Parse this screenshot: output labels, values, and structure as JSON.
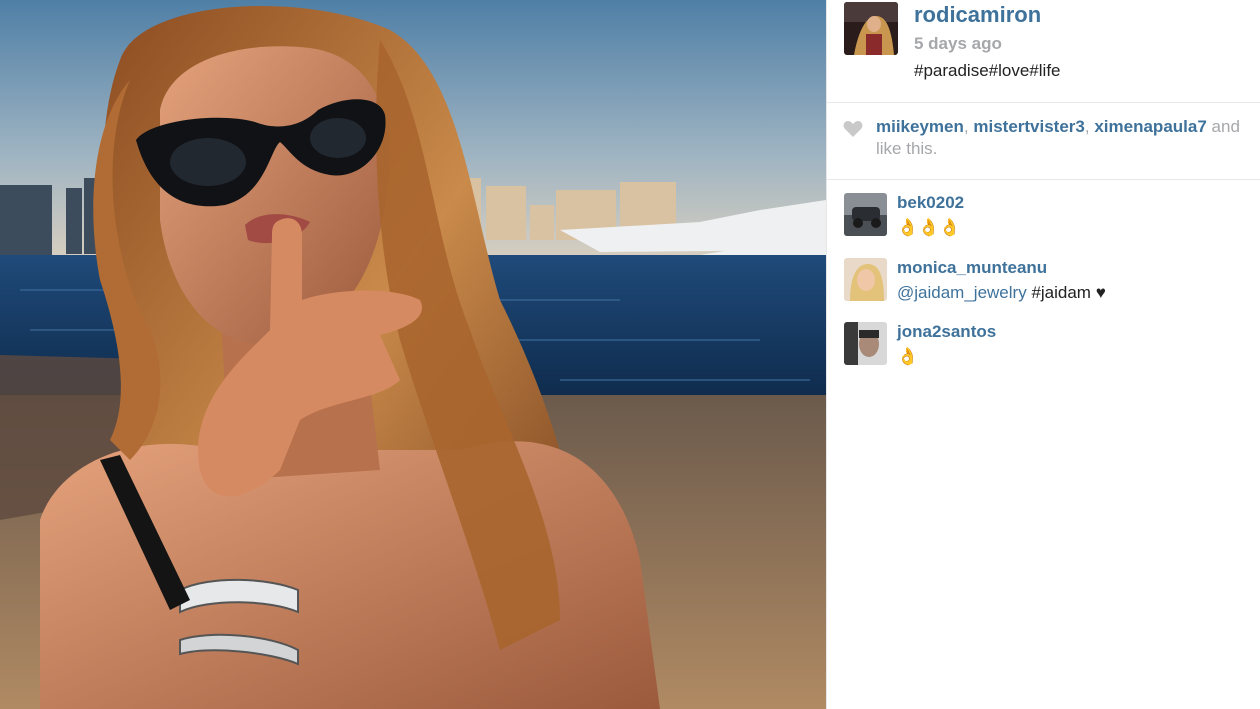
{
  "post": {
    "username": "rodicamiron",
    "time_ago": "5 days ago",
    "caption": "#paradise#love#life"
  },
  "likes": {
    "users": [
      "miikeymen",
      "mistertvister3",
      "ximenapaula7"
    ],
    "separator": ",",
    "trailing": "and",
    "suffix": "like this."
  },
  "comments": [
    {
      "user": "bek0202",
      "text": "👌👌👌"
    },
    {
      "user": "monica_munteanu",
      "mention": "@jaidam_jewelry",
      "text": "#jaidam",
      "emoji": "heart-icon"
    },
    {
      "user": "jona2santos",
      "text": "👌"
    }
  ],
  "colors": {
    "link": "#3f729b",
    "muted": "#a5a7aa",
    "text": "#222222",
    "divider": "#e8e8e8"
  }
}
